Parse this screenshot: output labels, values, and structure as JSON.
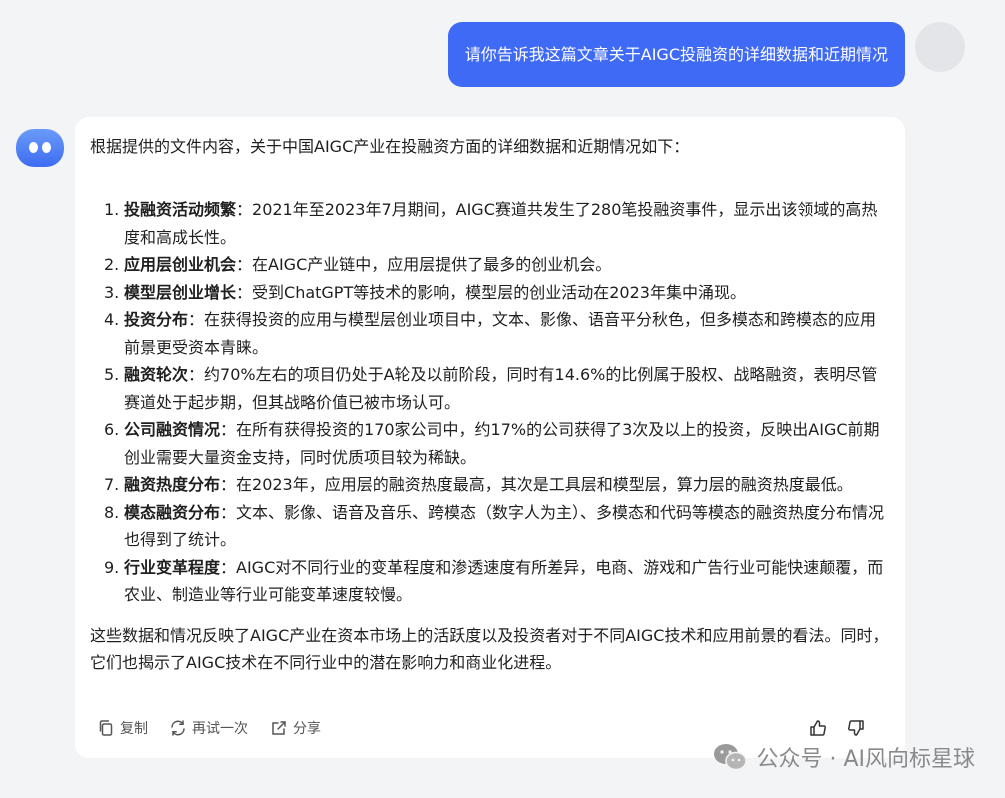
{
  "user_message": "请你告诉我这篇文章关于AIGC投融资的详细数据和近期情况",
  "answer": {
    "intro": "根据提供的文件内容，关于中国AIGC产业在投融资方面的详细数据和近期情况如下：",
    "items": [
      {
        "num": "1.",
        "title": "投融资活动频繁",
        "text": "：2021年至2023年7月期间，AIGC赛道共发生了280笔投融资事件，显示出该领域的高热度和高成长性。"
      },
      {
        "num": "2.",
        "title": "应用层创业机会",
        "text": "：在AIGC产业链中，应用层提供了最多的创业机会。"
      },
      {
        "num": "3.",
        "title": "模型层创业增长",
        "text": "：受到ChatGPT等技术的影响，模型层的创业活动在2023年集中涌现。"
      },
      {
        "num": "4.",
        "title": "投资分布",
        "text": "：在获得投资的应用与模型层创业项目中，文本、影像、语音平分秋色，但多模态和跨模态的应用前景更受资本青睐。"
      },
      {
        "num": "5.",
        "title": "融资轮次",
        "text": "：约70%左右的项目仍处于A轮及以前阶段，同时有14.6%的比例属于股权、战略融资，表明尽管赛道处于起步期，但其战略价值已被市场认可。"
      },
      {
        "num": "6.",
        "title": "公司融资情况",
        "text": "：在所有获得投资的170家公司中，约17%的公司获得了3次及以上的投资，反映出AIGC前期创业需要大量资金支持，同时优质项目较为稀缺。"
      },
      {
        "num": "7.",
        "title": "融资热度分布",
        "text": "：在2023年，应用层的融资热度最高，其次是工具层和模型层，算力层的融资热度最低。"
      },
      {
        "num": "8.",
        "title": "模态融资分布",
        "text": "：文本、影像、语音及音乐、跨模态（数字人为主）、多模态和代码等模态的融资热度分布情况也得到了统计。"
      },
      {
        "num": "9.",
        "title": "行业变革程度",
        "text": "：AIGC对不同行业的变革程度和渗透速度有所差异，电商、游戏和广告行业可能快速颠覆，而农业、制造业等行业可能变革速度较慢。"
      }
    ],
    "outro": "这些数据和情况反映了AIGC产业在资本市场上的活跃度以及投资者对于不同AIGC技术和应用前景的看法。同时，它们也揭示了AIGC技术在不同行业中的潜在影响力和商业化进程。"
  },
  "actions": {
    "copy": "复制",
    "retry": "再试一次",
    "share": "分享"
  },
  "icons": [
    "copy-icon",
    "retry-icon",
    "share-icon",
    "thumbs-up-icon",
    "thumbs-down-icon",
    "wechat-icon"
  ],
  "watermark": "公众号 · AI风向标星球",
  "colors": {
    "user_bubble": "#3f6af5",
    "background": "#f3f4f6",
    "card": "#ffffff"
  }
}
